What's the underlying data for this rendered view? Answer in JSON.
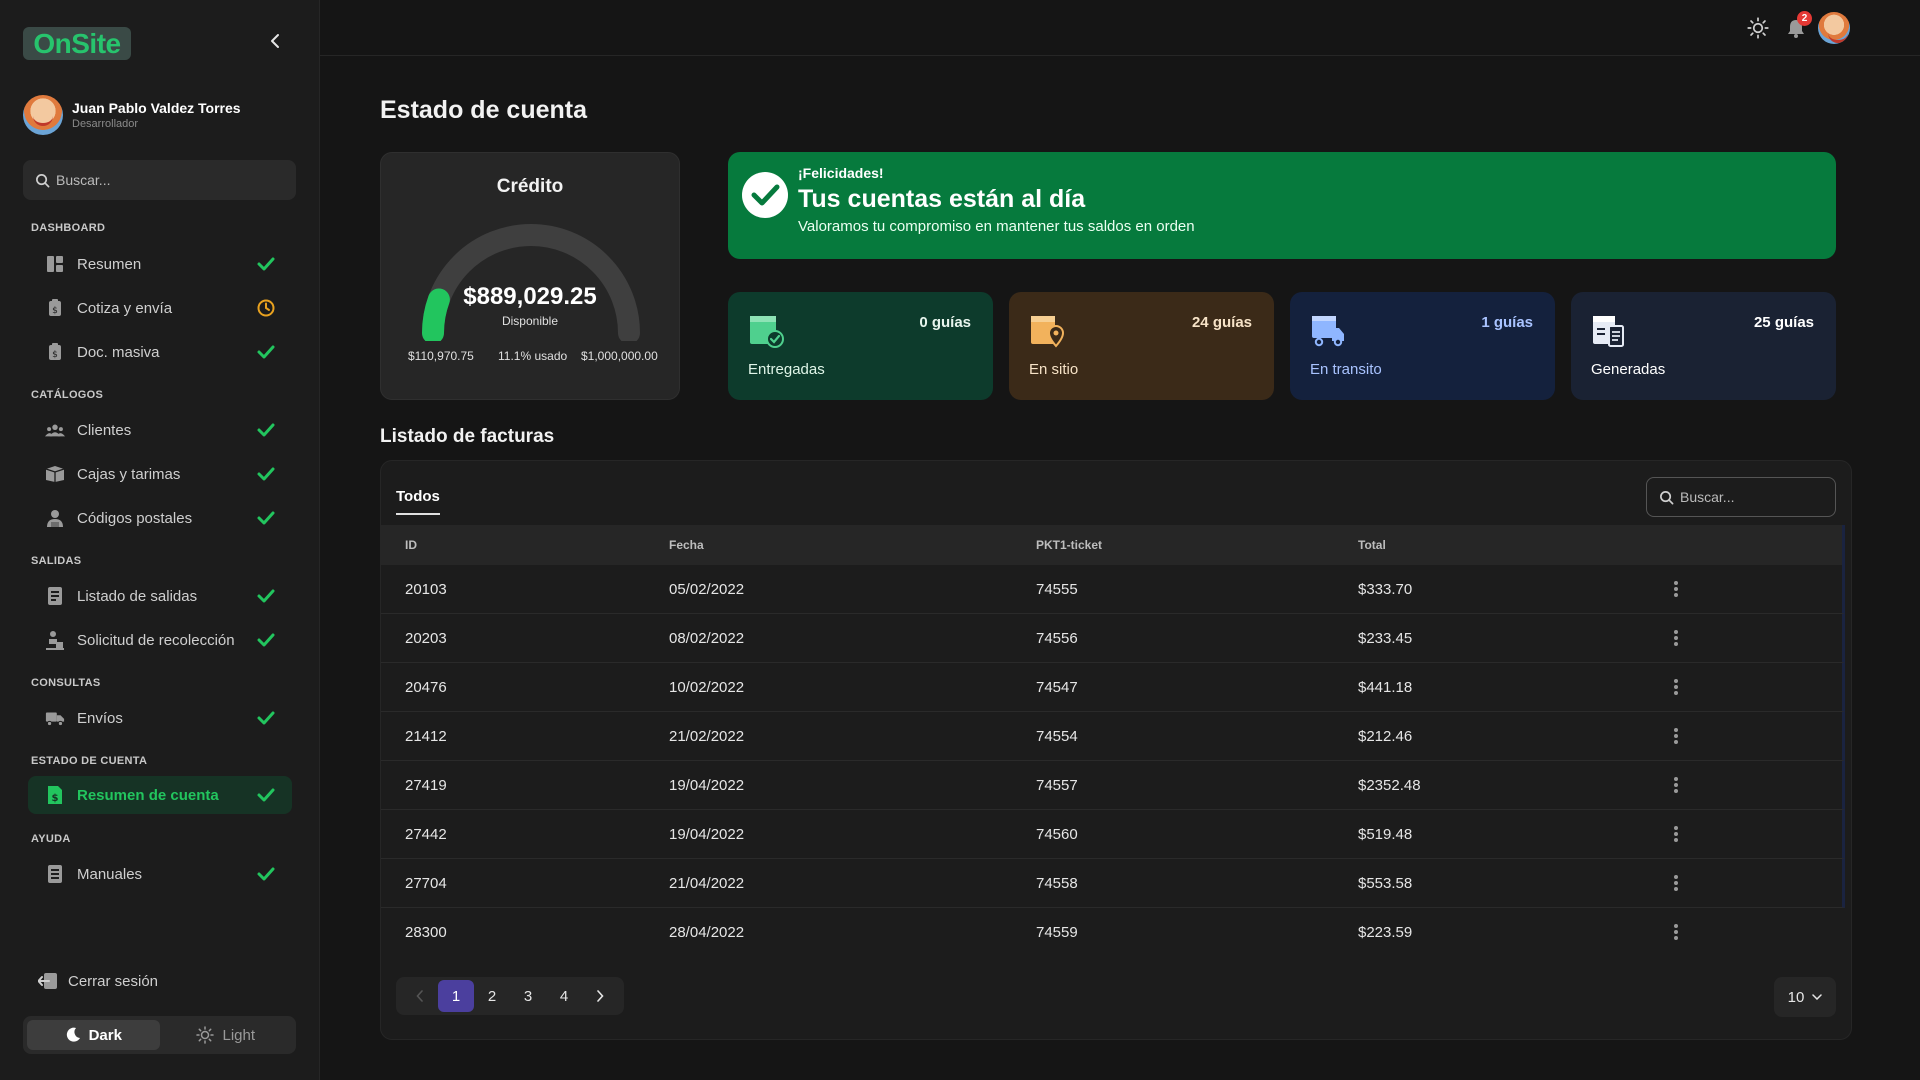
{
  "app": {
    "logo_text": "OnSite"
  },
  "user": {
    "name": "Juan Pablo Valdez Torres",
    "role": "Desarrollador"
  },
  "sidebar": {
    "search_placeholder": "Buscar...",
    "sections": [
      {
        "title": "DASHBOARD",
        "items": [
          {
            "label": "Resumen",
            "icon": "dashboard-icon",
            "status": "check"
          },
          {
            "label": "Cotiza y envía",
            "icon": "quote-icon",
            "status": "clock"
          },
          {
            "label": "Doc. masiva",
            "icon": "document-icon",
            "status": "check"
          }
        ]
      },
      {
        "title": "CATÁLOGOS",
        "items": [
          {
            "label": "Clientes",
            "icon": "users-icon",
            "status": "check"
          },
          {
            "label": "Cajas y tarimas",
            "icon": "box-icon",
            "status": "check"
          },
          {
            "label": "Códigos postales",
            "icon": "postal-icon",
            "status": "check"
          }
        ]
      },
      {
        "title": "SALIDAS",
        "items": [
          {
            "label": "Listado de salidas",
            "icon": "list-icon",
            "status": "check"
          },
          {
            "label": "Solicitud de recolección",
            "icon": "pickup-icon",
            "status": "check"
          }
        ]
      },
      {
        "title": "CONSULTAS",
        "items": [
          {
            "label": "Envíos",
            "icon": "truck-icon",
            "status": "check"
          }
        ]
      },
      {
        "title": "ESTADO DE CUENTA",
        "items": [
          {
            "label": "Resumen de cuenta",
            "icon": "invoice-icon",
            "status": "check",
            "active": true
          }
        ]
      },
      {
        "title": "AYUDA",
        "items": [
          {
            "label": "Manuales",
            "icon": "manual-icon",
            "status": "check"
          }
        ]
      }
    ],
    "logout_label": "Cerrar sesión",
    "theme": {
      "dark_label": "Dark",
      "light_label": "Light",
      "selected": "Dark"
    }
  },
  "topbar": {
    "notification_count": "2"
  },
  "page": {
    "title": "Estado de cuenta"
  },
  "credit": {
    "title": "Crédito",
    "available": "$889,029.25",
    "available_label": "Disponible",
    "used": "$110,970.75",
    "used_pct_label": "11.1% usado",
    "used_fraction": 0.111,
    "limit": "$1,000,000.00"
  },
  "banner": {
    "kicker": "¡Felicidades!",
    "title": "Tus cuentas están al día",
    "text": "Valoramos tu compromiso en mantener tus saldos en orden"
  },
  "stats": [
    {
      "count": "0 guías",
      "label": "Entregadas",
      "icon": "delivered-box-icon"
    },
    {
      "count": "24 guías",
      "label": "En sitio",
      "icon": "location-box-icon"
    },
    {
      "count": "1 guías",
      "label": "En transito",
      "icon": "transit-truck-icon"
    },
    {
      "count": "25 guías",
      "label": "Generadas",
      "icon": "generated-doc-icon"
    }
  ],
  "invoices": {
    "title": "Listado de facturas",
    "tab": "Todos",
    "search_placeholder": "Buscar...",
    "columns": [
      "ID",
      "Fecha",
      "PKT1-ticket",
      "Total"
    ],
    "rows": [
      [
        "20103",
        "05/02/2022",
        "74555",
        "$333.70"
      ],
      [
        "20203",
        "08/02/2022",
        "74556",
        "$233.45"
      ],
      [
        "20476",
        "10/02/2022",
        "74547",
        "$441.18"
      ],
      [
        "21412",
        "21/02/2022",
        "74554",
        "$212.46"
      ],
      [
        "27419",
        "19/04/2022",
        "74557",
        "$2352.48"
      ],
      [
        "27442",
        "19/04/2022",
        "74560",
        "$519.48"
      ],
      [
        "27704",
        "21/04/2022",
        "74558",
        "$553.58"
      ],
      [
        "28300",
        "28/04/2022",
        "74559",
        "$223.59"
      ]
    ],
    "pages": [
      "1",
      "2",
      "3",
      "4"
    ],
    "current_page": "1",
    "page_size": "10"
  },
  "colors": {
    "accent_green": "#22c55e",
    "banner_green": "#067a3d",
    "pagination_active": "#4b3f9e",
    "card_delivered": "#0d3b2c",
    "card_onsite": "#3b2a18",
    "card_transit": "#14213d",
    "card_generated": "#1a2233"
  }
}
